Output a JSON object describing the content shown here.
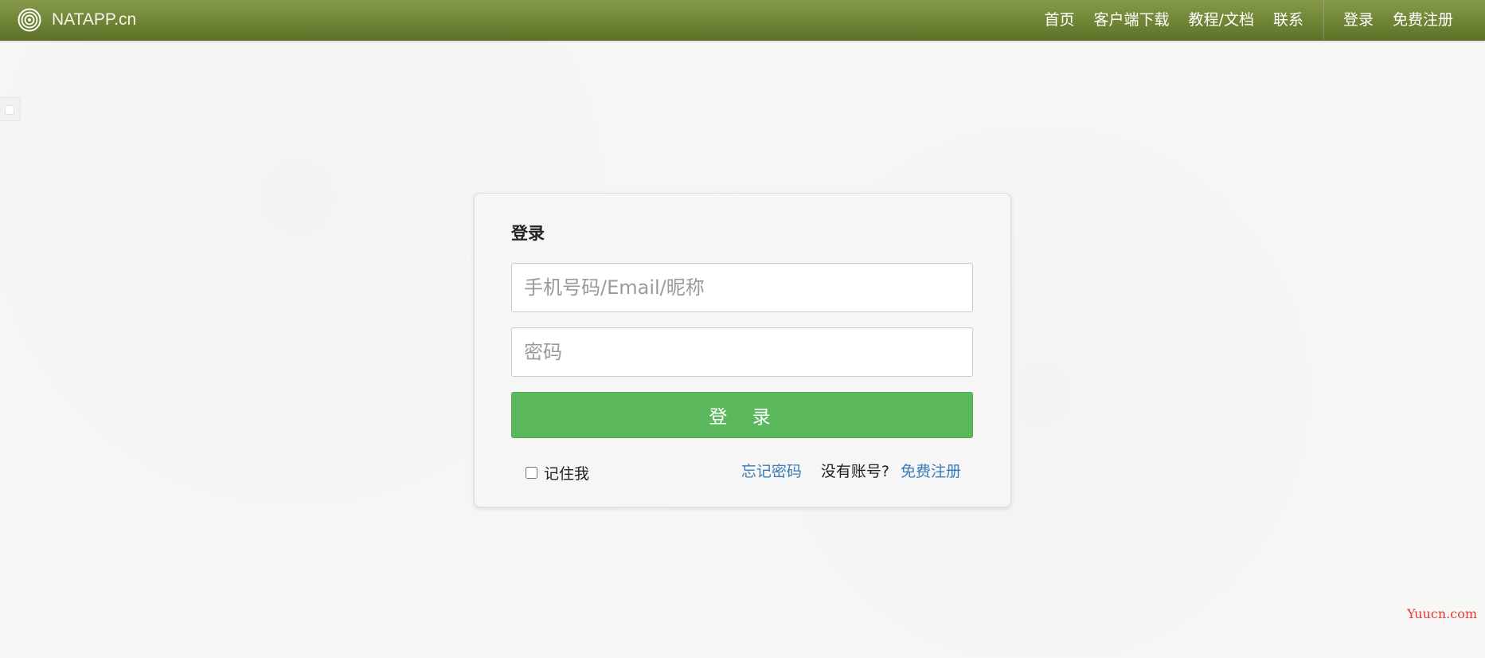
{
  "brand": {
    "name": "NATAPP.cn",
    "logo_icon": "spiral-logo-icon"
  },
  "nav": {
    "main_links": [
      {
        "label": "首页"
      },
      {
        "label": "客户端下载"
      },
      {
        "label": "教程/文档"
      },
      {
        "label": "联系"
      }
    ],
    "auth_links": [
      {
        "label": "登录"
      },
      {
        "label": "免费注册"
      }
    ]
  },
  "login": {
    "title": "登录",
    "account_placeholder": "手机号码/Email/昵称",
    "account_value": "",
    "password_placeholder": "密码",
    "password_value": "",
    "submit_label": "登 录",
    "remember_label": "记住我",
    "remember_checked": false,
    "forgot_label": "忘记密码",
    "no_account_text": "没有账号?",
    "register_label": "免费注册"
  },
  "watermark": {
    "text": "Yuucn.com"
  },
  "colors": {
    "navbar_top": "#86994a",
    "navbar_bottom": "#5d7229",
    "button_green": "#5cb85c",
    "link_blue": "#3a7bb8",
    "watermark_red": "#e53935"
  }
}
